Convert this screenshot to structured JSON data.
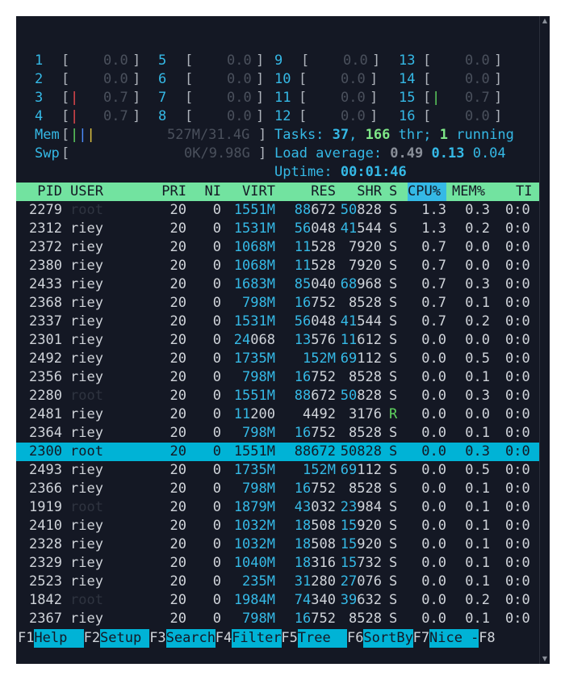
{
  "cpus": [
    {
      "id": "1",
      "value": "0.0",
      "bar": ""
    },
    {
      "id": "2",
      "value": "0.0",
      "bar": ""
    },
    {
      "id": "3",
      "value": "0.7",
      "bar": "|"
    },
    {
      "id": "4",
      "value": "0.7",
      "bar": "|"
    },
    {
      "id": "5",
      "value": "0.0",
      "bar": ""
    },
    {
      "id": "6",
      "value": "0.0",
      "bar": ""
    },
    {
      "id": "7",
      "value": "0.0",
      "bar": ""
    },
    {
      "id": "8",
      "value": "0.0",
      "bar": ""
    },
    {
      "id": "9",
      "value": "0.0",
      "bar": ""
    },
    {
      "id": "10",
      "value": "0.0",
      "bar": ""
    },
    {
      "id": "11",
      "value": "0.0",
      "bar": ""
    },
    {
      "id": "12",
      "value": "0.0",
      "bar": ""
    },
    {
      "id": "13",
      "value": "0.0",
      "bar": ""
    },
    {
      "id": "14",
      "value": "0.0",
      "bar": ""
    },
    {
      "id": "15",
      "value": "0.7",
      "bar": "|"
    },
    {
      "id": "16",
      "value": "0.0",
      "bar": ""
    }
  ],
  "mem": {
    "label": "Mem",
    "bars": "|||",
    "value": "527M/31.4G"
  },
  "swp": {
    "label": "Swp",
    "value": "0K/9.98G"
  },
  "tasks": {
    "label": "Tasks:",
    "count": "37",
    "sep": ",",
    "thr": "166",
    "thr_label": "thr;",
    "running": "1",
    "running_label": "running"
  },
  "load": {
    "label": "Load average:",
    "l1": "0.49",
    "l5": "0.13",
    "l15": "0.04"
  },
  "uptime": {
    "label": "Uptime:",
    "value": "00:01:46"
  },
  "columns": {
    "pid": "PID",
    "user": "USER",
    "pri": "PRI",
    "ni": "NI",
    "virt": "VIRT",
    "res": "RES",
    "shr": "SHR",
    "s": "S",
    "cpu": "CPU%",
    "mem": "MEM%",
    "time": "TI"
  },
  "processes": [
    {
      "pid": "2279",
      "user": "root",
      "pri": "20",
      "ni": "0",
      "virt": "1551M",
      "res_hi": "88",
      "res_lo": "672",
      "shr_hi": "50",
      "shr_lo": "828",
      "s": "S",
      "cpu": "1.3",
      "mem": "0.3",
      "time": "0:0"
    },
    {
      "pid": "2312",
      "user": "riey",
      "pri": "20",
      "ni": "0",
      "virt": "1531M",
      "res_hi": "56",
      "res_lo": "048",
      "shr_hi": "41",
      "shr_lo": "544",
      "s": "S",
      "cpu": "1.3",
      "mem": "0.2",
      "time": "0:0"
    },
    {
      "pid": "2372",
      "user": "riey",
      "pri": "20",
      "ni": "0",
      "virt": "1068M",
      "res_hi": "11",
      "res_lo": "528",
      "shr_hi": "",
      "shr_lo": "7920",
      "s": "S",
      "cpu": "0.7",
      "mem": "0.0",
      "time": "0:0"
    },
    {
      "pid": "2380",
      "user": "riey",
      "pri": "20",
      "ni": "0",
      "virt": "1068M",
      "res_hi": "11",
      "res_lo": "528",
      "shr_hi": "",
      "shr_lo": "7920",
      "s": "S",
      "cpu": "0.7",
      "mem": "0.0",
      "time": "0:0"
    },
    {
      "pid": "2433",
      "user": "riey",
      "pri": "20",
      "ni": "0",
      "virt": "1683M",
      "res_hi": "85",
      "res_lo": "040",
      "shr_hi": "68",
      "shr_lo": "968",
      "s": "S",
      "cpu": "0.7",
      "mem": "0.3",
      "time": "0:0"
    },
    {
      "pid": "2368",
      "user": "riey",
      "pri": "20",
      "ni": "0",
      "virt": "798M",
      "res_hi": "16",
      "res_lo": "752",
      "shr_hi": "",
      "shr_lo": "8528",
      "s": "S",
      "cpu": "0.7",
      "mem": "0.1",
      "time": "0:0"
    },
    {
      "pid": "2337",
      "user": "riey",
      "pri": "20",
      "ni": "0",
      "virt": "1531M",
      "res_hi": "56",
      "res_lo": "048",
      "shr_hi": "41",
      "shr_lo": "544",
      "s": "S",
      "cpu": "0.7",
      "mem": "0.2",
      "time": "0:0"
    },
    {
      "pid": "2301",
      "user": "riey",
      "pri": "20",
      "ni": "0",
      "virt": "24068",
      "res_hi": "13",
      "res_lo": "576",
      "shr_hi": "11",
      "shr_lo": "612",
      "s": "S",
      "cpu": "0.0",
      "mem": "0.0",
      "time": "0:0",
      "virt_plain": true
    },
    {
      "pid": "2492",
      "user": "riey",
      "pri": "20",
      "ni": "0",
      "virt": "1735M",
      "res_hi": "152M",
      "res_lo": "",
      "shr_hi": "69",
      "shr_lo": "112",
      "s": "S",
      "cpu": "0.0",
      "mem": "0.5",
      "time": "0:0"
    },
    {
      "pid": "2356",
      "user": "riey",
      "pri": "20",
      "ni": "0",
      "virt": "798M",
      "res_hi": "16",
      "res_lo": "752",
      "shr_hi": "",
      "shr_lo": "8528",
      "s": "S",
      "cpu": "0.0",
      "mem": "0.1",
      "time": "0:0"
    },
    {
      "pid": "2280",
      "user": "root",
      "pri": "20",
      "ni": "0",
      "virt": "1551M",
      "res_hi": "88",
      "res_lo": "672",
      "shr_hi": "50",
      "shr_lo": "828",
      "s": "S",
      "cpu": "0.0",
      "mem": "0.3",
      "time": "0:0"
    },
    {
      "pid": "2481",
      "user": "riey",
      "pri": "20",
      "ni": "0",
      "virt": "11200",
      "res_hi": "",
      "res_lo": "4492",
      "shr_hi": "",
      "shr_lo": "3176",
      "s": "R",
      "cpu": "0.0",
      "mem": "0.0",
      "time": "0:0",
      "virt_plain": true
    },
    {
      "pid": "2364",
      "user": "riey",
      "pri": "20",
      "ni": "0",
      "virt": "798M",
      "res_hi": "16",
      "res_lo": "752",
      "shr_hi": "",
      "shr_lo": "8528",
      "s": "S",
      "cpu": "0.0",
      "mem": "0.1",
      "time": "0:0"
    },
    {
      "pid": "2300",
      "user": "root",
      "pri": "20",
      "ni": "0",
      "virt": "1551M",
      "res_hi": "88",
      "res_lo": "672",
      "shr_hi": "50",
      "shr_lo": "828",
      "s": "S",
      "cpu": "0.0",
      "mem": "0.3",
      "time": "0:0",
      "selected": true
    },
    {
      "pid": "2493",
      "user": "riey",
      "pri": "20",
      "ni": "0",
      "virt": "1735M",
      "res_hi": "152M",
      "res_lo": "",
      "shr_hi": "69",
      "shr_lo": "112",
      "s": "S",
      "cpu": "0.0",
      "mem": "0.5",
      "time": "0:0"
    },
    {
      "pid": "2366",
      "user": "riey",
      "pri": "20",
      "ni": "0",
      "virt": "798M",
      "res_hi": "16",
      "res_lo": "752",
      "shr_hi": "",
      "shr_lo": "8528",
      "s": "S",
      "cpu": "0.0",
      "mem": "0.1",
      "time": "0:0"
    },
    {
      "pid": "1919",
      "user": "root",
      "pri": "20",
      "ni": "0",
      "virt": "1879M",
      "res_hi": "43",
      "res_lo": "032",
      "shr_hi": "23",
      "shr_lo": "984",
      "s": "S",
      "cpu": "0.0",
      "mem": "0.1",
      "time": "0:0"
    },
    {
      "pid": "2410",
      "user": "riey",
      "pri": "20",
      "ni": "0",
      "virt": "1032M",
      "res_hi": "18",
      "res_lo": "508",
      "shr_hi": "15",
      "shr_lo": "920",
      "s": "S",
      "cpu": "0.0",
      "mem": "0.1",
      "time": "0:0"
    },
    {
      "pid": "2328",
      "user": "riey",
      "pri": "20",
      "ni": "0",
      "virt": "1032M",
      "res_hi": "18",
      "res_lo": "508",
      "shr_hi": "15",
      "shr_lo": "920",
      "s": "S",
      "cpu": "0.0",
      "mem": "0.1",
      "time": "0:0"
    },
    {
      "pid": "2329",
      "user": "riey",
      "pri": "20",
      "ni": "0",
      "virt": "1040M",
      "res_hi": "18",
      "res_lo": "316",
      "shr_hi": "15",
      "shr_lo": "732",
      "s": "S",
      "cpu": "0.0",
      "mem": "0.1",
      "time": "0:0"
    },
    {
      "pid": "2523",
      "user": "riey",
      "pri": "20",
      "ni": "0",
      "virt": "235M",
      "res_hi": "31",
      "res_lo": "280",
      "shr_hi": "27",
      "shr_lo": "076",
      "s": "S",
      "cpu": "0.0",
      "mem": "0.1",
      "time": "0:0"
    },
    {
      "pid": "1842",
      "user": "root",
      "pri": "20",
      "ni": "0",
      "virt": "1984M",
      "res_hi": "74",
      "res_lo": "340",
      "shr_hi": "39",
      "shr_lo": "632",
      "s": "S",
      "cpu": "0.0",
      "mem": "0.2",
      "time": "0:0"
    },
    {
      "pid": "2367",
      "user": "riey",
      "pri": "20",
      "ni": "0",
      "virt": "798M",
      "res_hi": "16",
      "res_lo": "752",
      "shr_hi": "",
      "shr_lo": "8528",
      "s": "S",
      "cpu": "0.0",
      "mem": "0.1",
      "time": "0:0"
    }
  ],
  "fkeys": [
    {
      "key": "F1",
      "label": "Help  "
    },
    {
      "key": "F2",
      "label": "Setup "
    },
    {
      "key": "F3",
      "label": "Search"
    },
    {
      "key": "F4",
      "label": "Filter"
    },
    {
      "key": "F5",
      "label": "Tree  "
    },
    {
      "key": "F6",
      "label": "SortBy"
    },
    {
      "key": "F7",
      "label": "Nice -"
    },
    {
      "key": "F8",
      "label": ""
    }
  ],
  "colors": {
    "cyan": "#35b9e6",
    "green": "#72e3a0",
    "selection": "#00b3d6",
    "background": "#141824",
    "red": "#e5484d"
  }
}
